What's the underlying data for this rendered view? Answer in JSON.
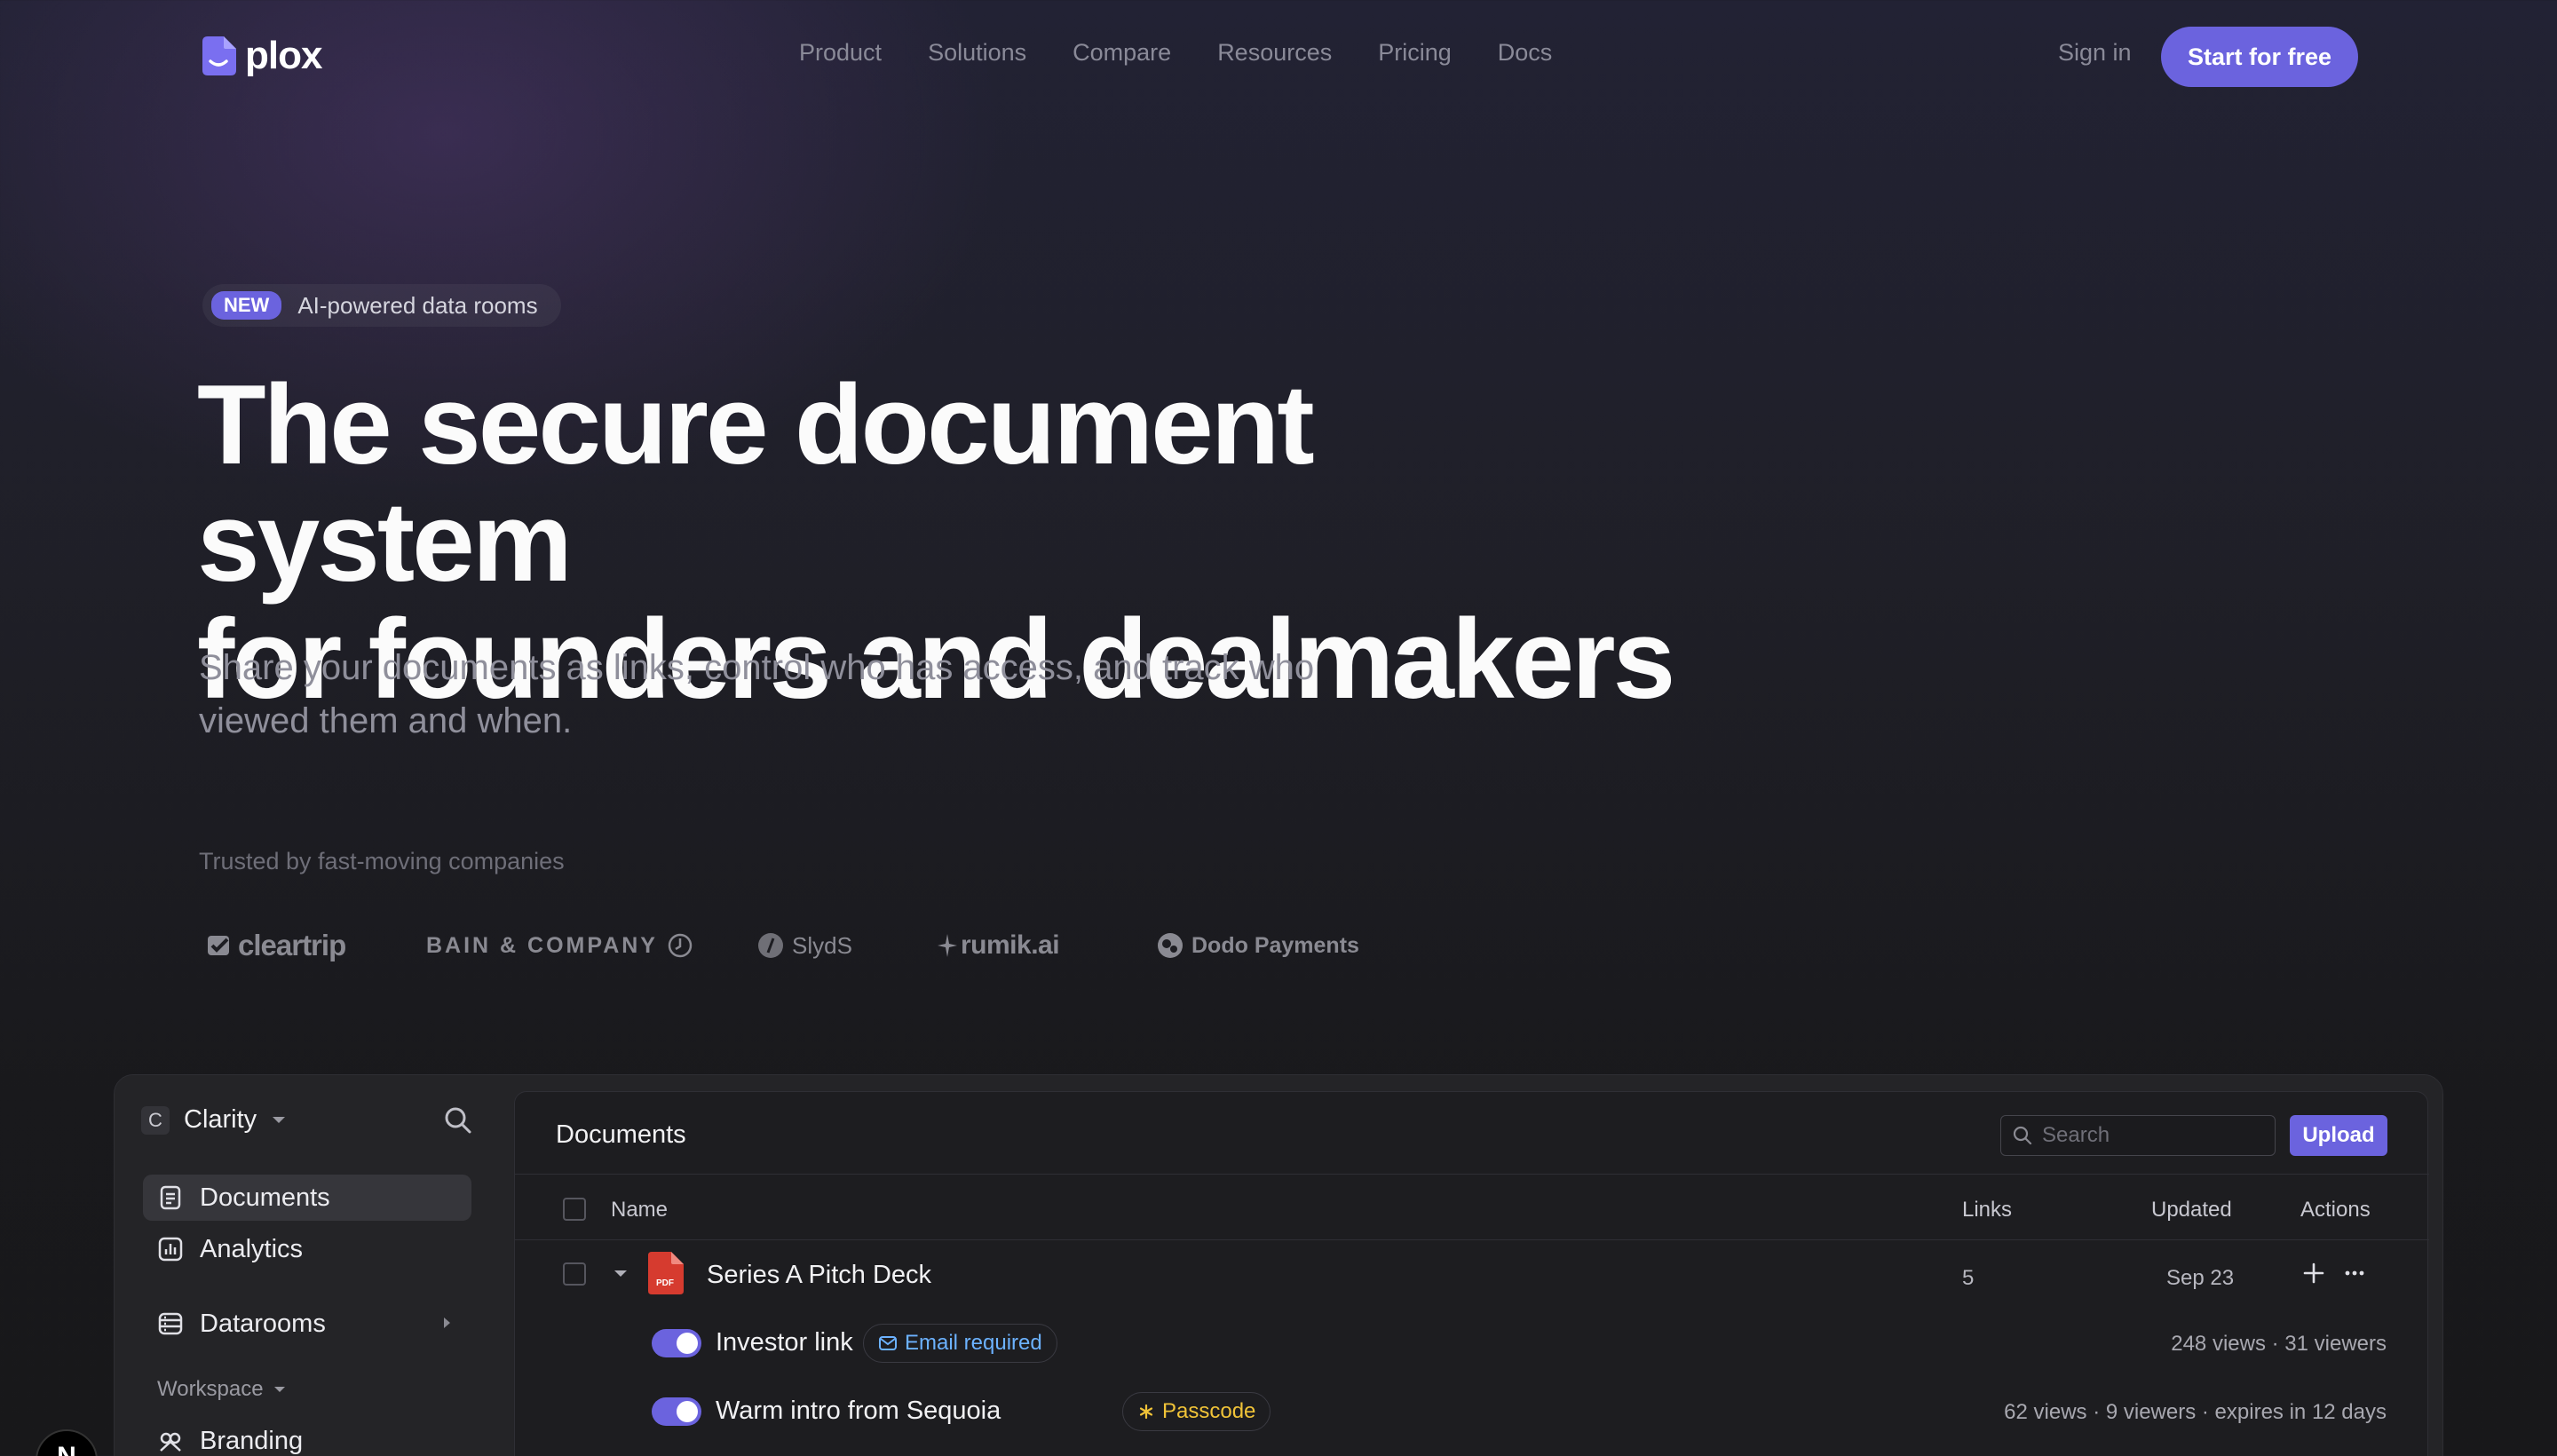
{
  "brand": {
    "name": "plox",
    "accent": "#6b63de"
  },
  "nav": {
    "links": [
      "Product",
      "Solutions",
      "Compare",
      "Resources",
      "Pricing",
      "Docs"
    ],
    "signin": "Sign in",
    "cta": "Start for free"
  },
  "hero": {
    "badge_new": "NEW",
    "badge_text": "AI-powered data rooms",
    "title_line1": "The secure document system",
    "title_line2": "for founders and dealmakers",
    "subtitle_line1": "Share your documents as links, control who has access, and track who",
    "subtitle_line2": "viewed them and when.",
    "trusted": "Trusted by fast-moving companies",
    "logos": [
      "cleartrip",
      "BAIN & COMPANY",
      "SlydS",
      "rumik.ai",
      "Dodo Payments"
    ]
  },
  "app": {
    "workspace": {
      "initial": "C",
      "name": "Clarity"
    },
    "sidebar": {
      "items": [
        {
          "label": "Documents",
          "icon": "document-icon",
          "active": true
        },
        {
          "label": "Analytics",
          "icon": "chart-icon"
        },
        {
          "label": "Datarooms",
          "icon": "dataroom-icon"
        }
      ],
      "section": "Workspace",
      "section_items": [
        {
          "label": "Branding",
          "icon": "brush-icon"
        }
      ]
    },
    "main": {
      "title": "Documents",
      "search_placeholder": "Search",
      "upload": "Upload",
      "columns": {
        "name": "Name",
        "links": "Links",
        "updated": "Updated",
        "actions": "Actions"
      },
      "rows": [
        {
          "name": "Series A Pitch Deck",
          "file_type": "PDF",
          "links": "5",
          "updated": "Sep 23",
          "links_list": [
            {
              "name": "Investor link",
              "tag": "Email required",
              "stats": "248 views · 31 viewers"
            },
            {
              "name": "Warm intro from Sequoia",
              "tag": "Passcode",
              "stats": "62 views · 9 viewers · expires in 12 days"
            }
          ]
        }
      ]
    }
  },
  "floating_badge": "N"
}
